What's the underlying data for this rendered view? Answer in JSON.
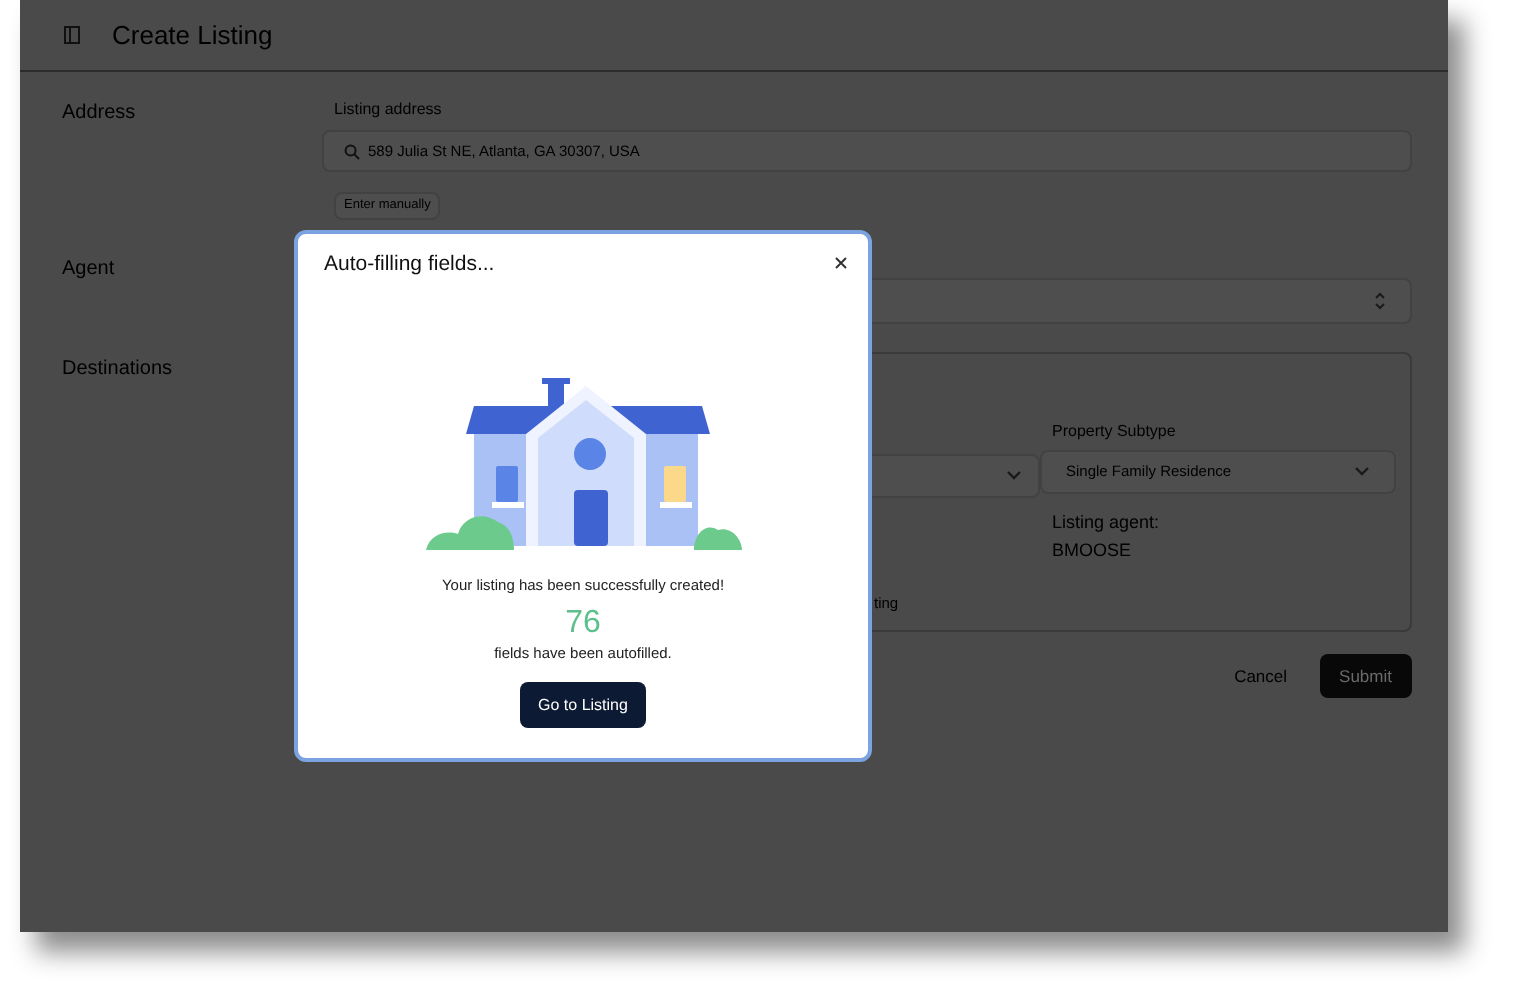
{
  "header": {
    "title": "Create Listing"
  },
  "form": {
    "address_label": "Address",
    "listing_address_label": "Listing address",
    "listing_address_value": "589 Julia St NE, Atlanta, GA 30307, USA",
    "enter_manually": "Enter manually",
    "agent_label": "Agent",
    "destinations_label": "Destinations",
    "property_subtype_label": "Property Subtype",
    "property_subtype_value": "Single Family Residence",
    "listing_agent_label": "Listing agent:",
    "listing_agent_value": "BMOOSE",
    "partial_text": "ting"
  },
  "actions": {
    "cancel": "Cancel",
    "submit": "Submit"
  },
  "modal": {
    "title": "Auto-filling fields...",
    "message": "Your listing has been successfully created!",
    "count": "76",
    "count_caption": "fields have been autofilled.",
    "button": "Go to Listing"
  }
}
